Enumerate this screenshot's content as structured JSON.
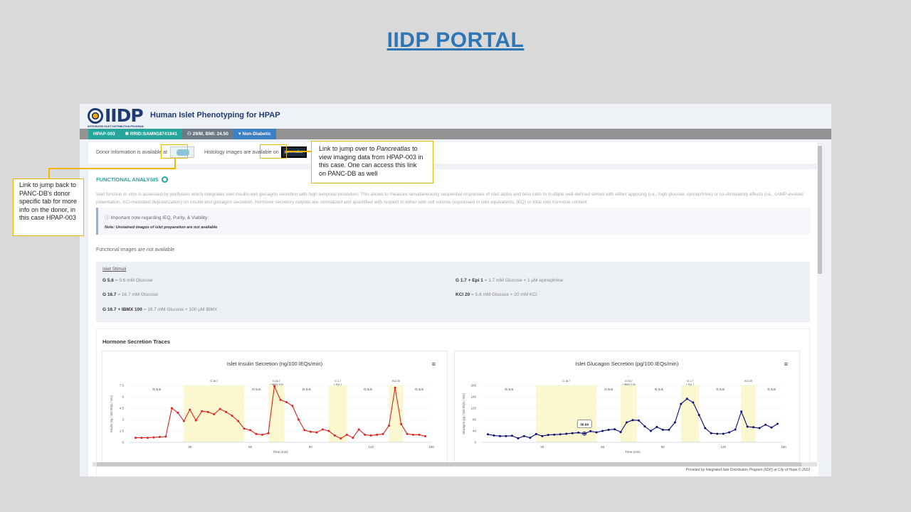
{
  "slide": {
    "title": "IIDP PORTAL"
  },
  "app": {
    "logo_text": "IIDP",
    "logo_subtext": "INTEGRATED ISLET DISTRIBUTION PROGRAM",
    "title": "Human Islet Phenotyping for HPAP",
    "chips": [
      "HPAP-003",
      "RRID:SAMN18741941",
      "29/M, BMI: 24.50",
      "Non-Diabetic"
    ],
    "donor_info_text": "Donor information is available at",
    "histology_text": "Histology images are available on",
    "pancreatlas_badge": "pancreatlas",
    "functional_analysis_title": "FUNCTIONAL ANALYSIS",
    "functional_desc": "Islet function in vitro is assessed by perifusion which integrates islet insulin and glucagon secretion with high temporal resolution. This allows to measure simultaneously sequential responses of islet alpha and beta cells to multiple well-defined stimuli with either apposing (i.e., high glucose, epinephrine) or co-stimulatory effects (i.e., cAMP-evoked potentiation, KCl-mediated depolarization) on insulin and glucagon secretion. Hormone secretory outputs are normalized and quantified with respect to either islet cell volume (expressed in islet equivalents, IEQ) or total islet hormone content.",
    "note_title": "Important note regarding IEQ, Purity, & Viability:",
    "note_text": "Note: Unstained images of islet preparation are not available",
    "functional_images_na": "Functional images are not available",
    "stimuli_header": "Islet Stimuli",
    "stimuli": [
      {
        "key": "G 5.6",
        "desc": " = 5.6 mM Glucose"
      },
      {
        "key": "G 1.7 + Epi 1",
        "desc": " = 1.7 mM Glucose + 1 µM epinephrine"
      },
      {
        "key": "G 16.7",
        "desc": " = 16.7 mM Glucose"
      },
      {
        "key": "KCl 20",
        "desc": " = 5.6 mM Glucose + 20 mM KCl"
      },
      {
        "key": "G 16.7 + IBMX 100",
        "desc": " = 16.7 mM Glucose + 100 µM IBMX"
      }
    ],
    "traces_title": "Hormone Secretion Traces",
    "footer": "Provided by Integrated Islet Distribution Program (IIDP) at City of Hope © 2022"
  },
  "annotations": {
    "left": "Link to jump back to PANC-DB's donor specific tab for more info on the donor, in this case HPAP-003",
    "right_pre": "Link to jump over to ",
    "right_em": "Pancreatlas",
    "right_post": " to view imaging data from HPAP-003 in this case. One can access this link on PANC-DB as well"
  },
  "chart_data": [
    {
      "type": "line",
      "title": "Islet Insulin Secretion (ng/100 IEQs/min)",
      "xlabel": "Time (min)",
      "ylabel": "Insulin (ng / 100 IEQs / min)",
      "color": "#e3211c",
      "xlim": [
        0,
        150
      ],
      "ylim": [
        0,
        7.5
      ],
      "xticks": [
        30,
        60,
        90,
        120,
        150
      ],
      "yticks": [
        0,
        1.5,
        3,
        4.5,
        6,
        7.5
      ],
      "ytick_labels": [
        "0",
        "1.5",
        "3",
        "4.5",
        "6",
        "7.5"
      ],
      "bands": [
        {
          "label": "G 5.6",
          "x0": 0,
          "x1": 27,
          "shaded": false
        },
        {
          "label": "G 16.7",
          "x0": 27,
          "x1": 57,
          "shaded": true
        },
        {
          "label": "G 5.6",
          "x0": 57,
          "x1": 69,
          "shaded": false
        },
        {
          "label": "G 16.7\n+ IBMX 100",
          "x0": 69,
          "x1": 77,
          "shaded": true
        },
        {
          "label": "G 5.6",
          "x0": 77,
          "x1": 99,
          "shaded": false
        },
        {
          "label": "G 1.7\n+ Epi 1",
          "x0": 99,
          "x1": 108,
          "shaded": true
        },
        {
          "label": "G 5.6",
          "x0": 108,
          "x1": 129,
          "shaded": false
        },
        {
          "label": "KCl 20",
          "x0": 129,
          "x1": 136,
          "shaded": true
        },
        {
          "label": "G 5.6",
          "x0": 136,
          "x1": 152,
          "shaded": false
        }
      ],
      "x": [
        3,
        6,
        9,
        12,
        15,
        18,
        21,
        24,
        27,
        30,
        33,
        36,
        39,
        42,
        45,
        48,
        51,
        54,
        57,
        60,
        63,
        66,
        69,
        72,
        75,
        78,
        81,
        84,
        87,
        90,
        93,
        96,
        99,
        102,
        105,
        108,
        111,
        114,
        117,
        120,
        123,
        126,
        129,
        132,
        135,
        138,
        141,
        144,
        147
      ],
      "values": [
        0.6,
        0.6,
        0.6,
        0.65,
        0.7,
        0.75,
        4.5,
        3.9,
        2.8,
        4.3,
        2.9,
        4.1,
        4.0,
        3.7,
        4.4,
        4.0,
        3.5,
        2.8,
        1.8,
        1.6,
        1.1,
        1.0,
        1.2,
        7.4,
        5.6,
        5.3,
        4.8,
        3.0,
        1.6,
        1.4,
        1.3,
        1.7,
        1.5,
        0.9,
        0.5,
        1.0,
        0.6,
        1.7,
        1.0,
        0.9,
        1.0,
        1.1,
        2.2,
        7.2,
        2.4,
        1.1,
        1.0,
        1.0,
        0.8
      ]
    },
    {
      "type": "line",
      "title": "Islet Glucagon Secretion (pg/100 IEQs/min)",
      "xlabel": "Time (min)",
      "ylabel": "Glucagon (pg / 100 IEQs / min)",
      "color": "#0a0a7a",
      "xlim": [
        0,
        150
      ],
      "ylim": [
        0,
        200
      ],
      "xticks": [
        30,
        60,
        90,
        120,
        150
      ],
      "yticks": [
        0,
        40,
        80,
        120,
        160,
        200
      ],
      "ytick_labels": [
        "0",
        "40",
        "80",
        "120",
        "160",
        "200"
      ],
      "tooltip": "30.60",
      "bands": [
        {
          "label": "G 5.6",
          "x0": 0,
          "x1": 27,
          "shaded": false
        },
        {
          "label": "G 16.7",
          "x0": 27,
          "x1": 57,
          "shaded": true
        },
        {
          "label": "G 5.6",
          "x0": 57,
          "x1": 69,
          "shaded": false
        },
        {
          "label": "G 16.7\n+ IBMX 100",
          "x0": 69,
          "x1": 77,
          "shaded": true
        },
        {
          "label": "G 5.6",
          "x0": 77,
          "x1": 99,
          "shaded": false
        },
        {
          "label": "G 1.7\n+ Epi 1",
          "x0": 99,
          "x1": 108,
          "shaded": true
        },
        {
          "label": "G 5.6",
          "x0": 108,
          "x1": 129,
          "shaded": false
        },
        {
          "label": "KCl 20",
          "x0": 129,
          "x1": 136,
          "shaded": true
        },
        {
          "label": "G 5.6",
          "x0": 136,
          "x1": 152,
          "shaded": false
        }
      ],
      "x": [
        3,
        6,
        9,
        12,
        15,
        18,
        21,
        24,
        27,
        30,
        33,
        36,
        39,
        42,
        45,
        48,
        51,
        54,
        57,
        60,
        63,
        66,
        69,
        72,
        75,
        78,
        81,
        84,
        87,
        90,
        93,
        96,
        99,
        102,
        105,
        108,
        111,
        114,
        117,
        120,
        123,
        126,
        129,
        132,
        135,
        138,
        141,
        144,
        147
      ],
      "values": [
        28,
        24,
        22,
        22,
        23,
        14,
        22,
        16,
        29,
        22,
        26,
        27,
        28,
        30,
        32,
        34,
        30.6,
        39,
        35,
        40,
        44,
        46,
        36,
        70,
        78,
        77,
        56,
        40,
        54,
        44,
        44,
        70,
        135,
        153,
        140,
        96,
        50,
        32,
        30,
        30,
        35,
        45,
        108,
        55,
        53,
        50,
        62,
        52,
        65
      ]
    }
  ]
}
